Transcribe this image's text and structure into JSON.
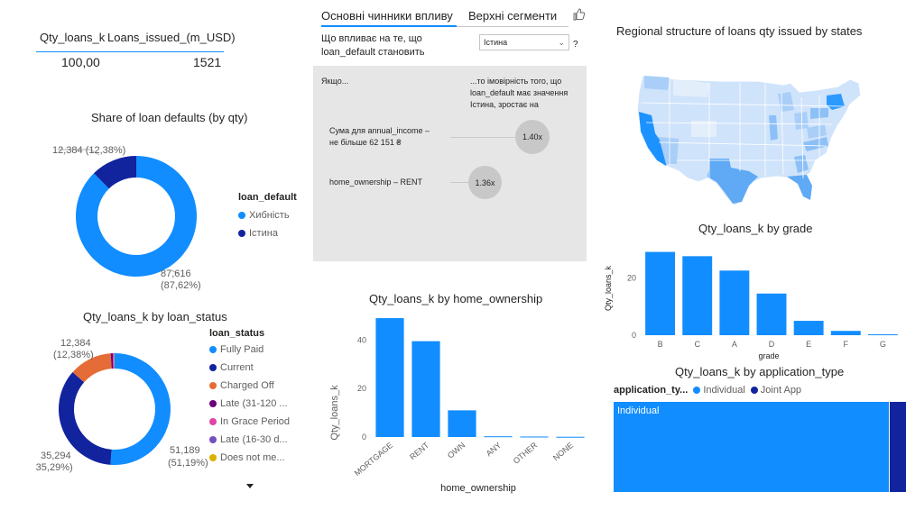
{
  "kpis": {
    "qty_label": "Qty_loans_k",
    "qty_value": "100,00",
    "issued_label": "Loans_issued_(m_USD)",
    "issued_value": "1521"
  },
  "defaults_chart": {
    "title": "Share of loan defaults (by qty)",
    "legend_title": "loan_default",
    "labels": {
      "small": "12,384 (12,38%)",
      "big_value": "87,616",
      "big_pct": "(87,62%)"
    },
    "chart_data": {
      "type": "pie",
      "title": "Share of loan defaults (by qty)",
      "categories": [
        "Хибність",
        "Істина"
      ],
      "values": [
        87616,
        12384
      ],
      "colors": [
        "#118dff",
        "#12239e"
      ],
      "legend": "right"
    }
  },
  "status_chart": {
    "title": "Qty_loans_k by loan_status",
    "legend_title": "loan_status",
    "labels": {
      "top_value": "12,384",
      "top_pct": "(12,38%)",
      "left_value": "35,294",
      "left_pct": "(35,29%)",
      "right_value": "51,189",
      "right_pct": "(51,19%)"
    },
    "chart_data": {
      "type": "pie",
      "title": "Qty_loans_k by loan_status",
      "categories": [
        "Fully Paid",
        "Current",
        "Charged Off",
        "Late (31-120 ...",
        "In Grace Period",
        "Late (16-30 d...",
        "Does not me..."
      ],
      "values": [
        51189,
        35294,
        12384,
        600,
        300,
        150,
        83
      ],
      "colors": [
        "#118dff",
        "#12239e",
        "#e66c37",
        "#6b007b",
        "#e044a7",
        "#744ec2",
        "#d9b300"
      ],
      "legend": "right"
    }
  },
  "key_influencers": {
    "tab_main": "Основні чинники впливу",
    "tab_segments": "Верхні сегменти",
    "question_line1": "Що впливає на те, що",
    "question_line2": "loan_default становить",
    "select_value": "Істина",
    "help": "?",
    "when_label": "Якщо...",
    "then_line1": "...то імовірність того, що",
    "then_line2": "loan_default має значення",
    "then_line3": "Істина, зростає на",
    "items": [
      {
        "line1": "Сума для annual_income –",
        "line2": "не більше 62 151 ₴",
        "value": "1.40x"
      },
      {
        "line1": "home_ownership – RENT",
        "line2": "",
        "value": "1.36x"
      }
    ]
  },
  "home_chart": {
    "title": "Qty_loans_k by home_ownership",
    "chart_data": {
      "type": "bar",
      "title": "Qty_loans_k by home_ownership",
      "categories": [
        "MORTGAGE",
        "RENT",
        "OWN",
        "ANY",
        "OTHER",
        "NONE"
      ],
      "values": [
        49,
        39.5,
        11,
        0.3,
        0.2,
        0.1
      ],
      "xlabel": "home_ownership",
      "ylabel": "Qty_loans_k",
      "ylim": [
        0,
        52
      ],
      "yticks": [
        0,
        20,
        40
      ],
      "color": "#118dff"
    }
  },
  "map": {
    "title": "Regional structure of loans qty issued by states"
  },
  "grade_chart": {
    "title": "Qty_loans_k by grade",
    "chart_data": {
      "type": "bar",
      "title": "Qty_loans_k by grade",
      "categories": [
        "B",
        "C",
        "A",
        "D",
        "E",
        "F",
        "G"
      ],
      "values": [
        29,
        27.5,
        22.5,
        14.5,
        5,
        1.5,
        0.3
      ],
      "xlabel": "grade",
      "ylabel": "Qty_loans_k",
      "ylim": [
        0,
        32
      ],
      "yticks": [
        0,
        20
      ],
      "color": "#118dff"
    }
  },
  "app_chart": {
    "title": "Qty_loans_k by application_type",
    "legend_title": "application_ty...",
    "tile_label": "Individual",
    "chart_data": {
      "type": "bar",
      "title": "Qty_loans_k by application_type",
      "categories": [
        "Individual",
        "Joint App"
      ],
      "values": [
        94.5,
        5.5
      ],
      "colors": [
        "#118dff",
        "#12239e"
      ],
      "legend": "top-left"
    }
  }
}
